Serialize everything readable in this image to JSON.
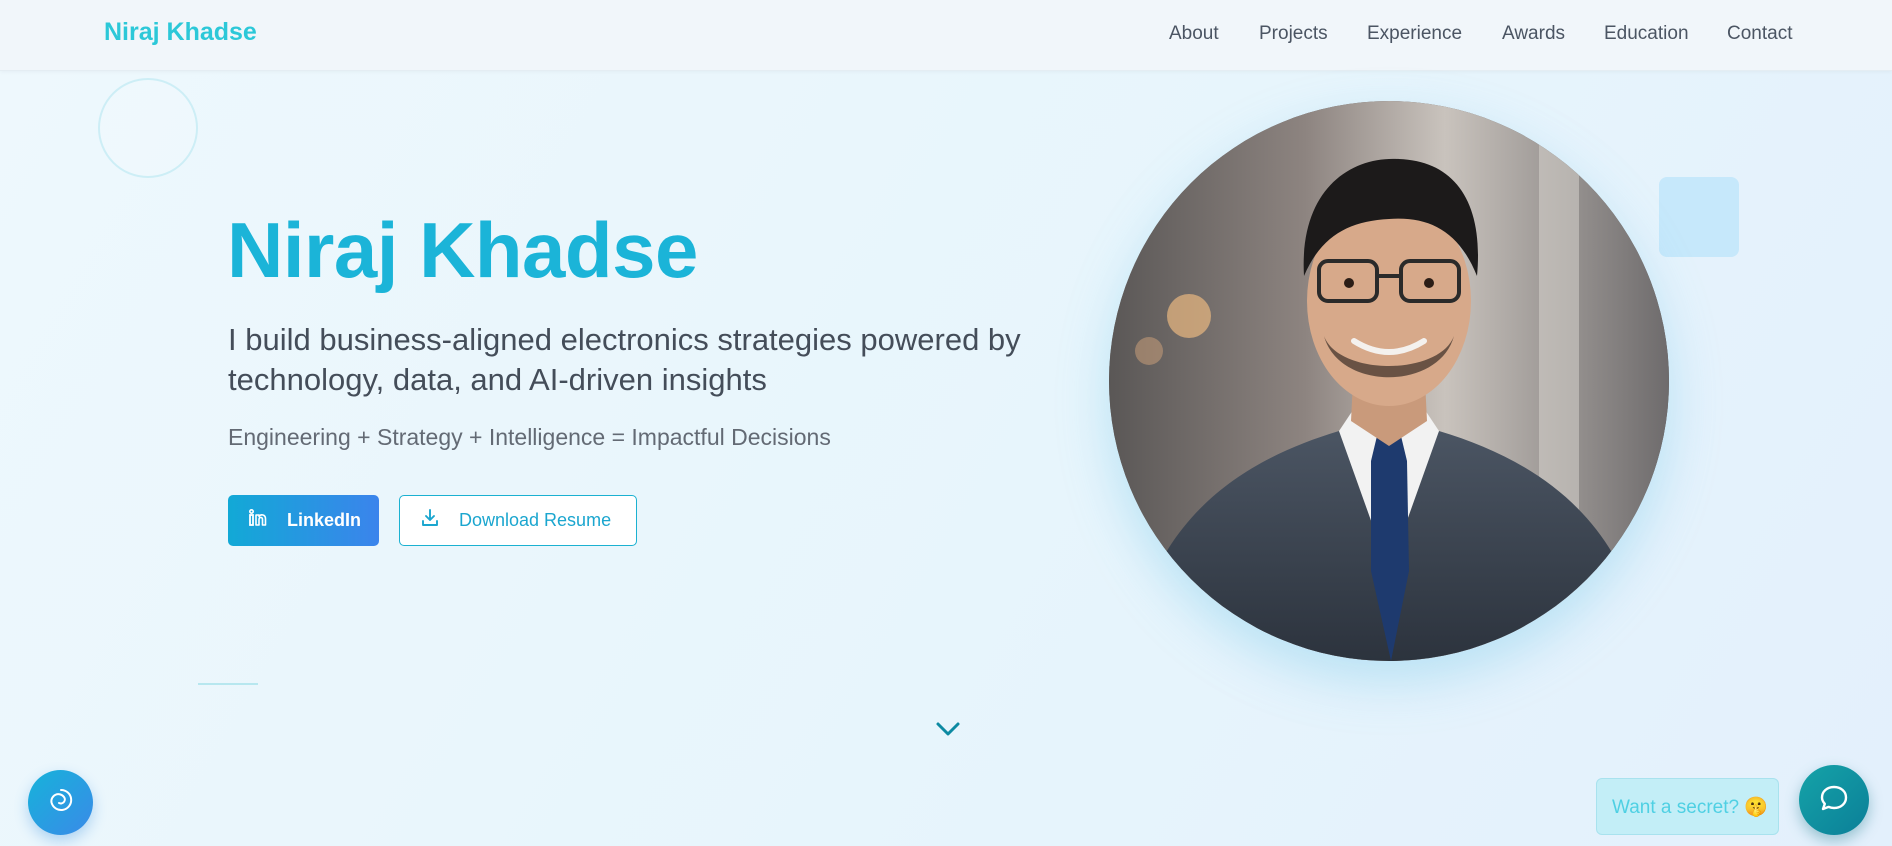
{
  "nav": {
    "brand": "Niraj Khadse",
    "links": [
      "About",
      "Projects",
      "Experience",
      "Awards",
      "Education",
      "Contact"
    ]
  },
  "hero": {
    "title": "Niraj Khadse",
    "subtitle": "I build business-aligned electronics strategies powered by technology, data, and AI-driven insights",
    "tagline": "Engineering + Strategy + Intelligence = Impactful Decisions",
    "linkedin_label": "LinkedIn",
    "resume_label": "Download Resume"
  },
  "portrait": {
    "alt": "Niraj Khadse"
  },
  "floating": {
    "secret_label": "Want a secret? 🤫"
  },
  "colors": {
    "brand": "#2cc8d8",
    "accent": "#1bb4d8",
    "primary_button_start": "#12a9d6",
    "primary_button_end": "#3b84ec",
    "chat_button": "#0f8f9f"
  },
  "icons": {
    "linkedin": "linkedin-icon",
    "download": "download-icon",
    "scroll": "chevron-down-icon",
    "chat": "chat-icon",
    "left_fab": "spiral-icon"
  }
}
